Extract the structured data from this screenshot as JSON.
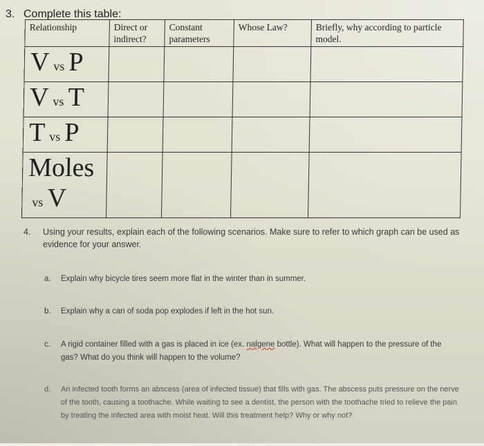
{
  "question3": {
    "number": "3.",
    "title": "Complete this table:",
    "table": {
      "headers": [
        "Relationship",
        "Direct or indirect?",
        "Constant parameters",
        "Whose Law?",
        "Briefly, why according to particle model."
      ],
      "rows": [
        {
          "left": "V",
          "vs": "vs",
          "right": "P",
          "cells": [
            "",
            "",
            "",
            ""
          ]
        },
        {
          "left": "V",
          "vs": "vs",
          "right": "T",
          "cells": [
            "",
            "",
            "",
            ""
          ]
        },
        {
          "left": "T",
          "vs": "vs",
          "right": "P",
          "cells": [
            "",
            "",
            "",
            ""
          ]
        },
        {
          "left": "Moles",
          "vs": "vs",
          "right": "V",
          "cells": [
            "",
            "",
            "",
            ""
          ]
        }
      ]
    }
  },
  "question4": {
    "number": "4.",
    "text": "Using your results, explain each of the following scenarios.  Make sure to refer to which graph can be used as evidence for your answer.",
    "parts": [
      {
        "letter": "a.",
        "text": "Explain why bicycle tires seem more flat in the winter than in summer."
      },
      {
        "letter": "b.",
        "text": "Explain why a can of soda pop explodes if left in the hot sun."
      },
      {
        "letter": "c.",
        "text_before": "A rigid container filled with a gas is placed in ice (ex. ",
        "flagged_word": "nalgene",
        "text_after": " bottle).  What will happen to the pressure of the gas?  What do you think will happen to the volume?"
      },
      {
        "letter": "d.",
        "text": "An infected tooth forms an abscess (area of infected tissue) that fills with gas.  The abscess puts pressure on the nerve of the tooth, causing a toothache.  While waiting to see a dentist, the person with the toothache tried to relieve the pain by treating the infected area with moist heat.  Will this treatment help?  Why or why not?"
      }
    ]
  }
}
